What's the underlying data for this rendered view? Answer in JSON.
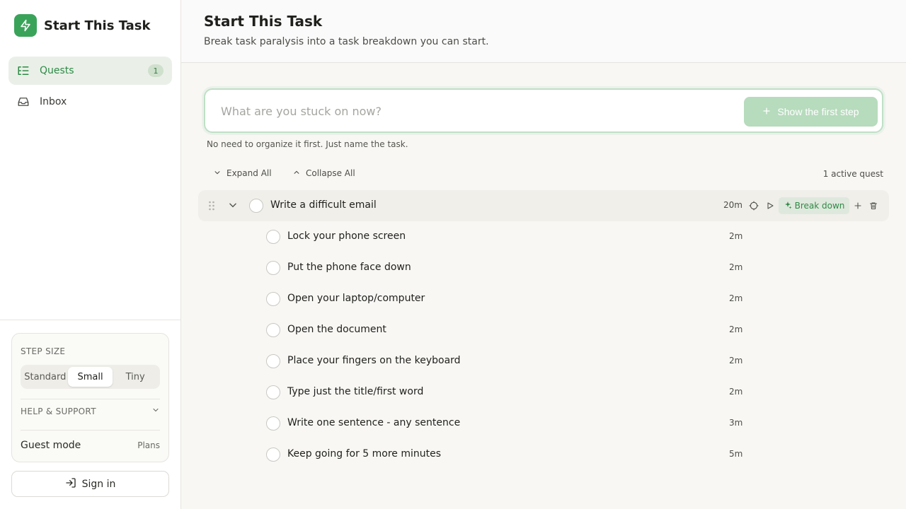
{
  "app": {
    "name": "Start This Task",
    "accent": "#3aa35a"
  },
  "sidebar": {
    "items": [
      {
        "label": "Quests",
        "icon": "list-tree-icon",
        "badge": "1",
        "active": true
      },
      {
        "label": "Inbox",
        "icon": "inbox-icon",
        "active": false
      }
    ],
    "step_size": {
      "label": "STEP SIZE",
      "options": [
        "Standard",
        "Small",
        "Tiny"
      ],
      "selected": "Small"
    },
    "help": {
      "label": "HELP & SUPPORT"
    },
    "guest": {
      "label": "Guest mode",
      "plans": "Plans"
    },
    "signin": {
      "label": "Sign in"
    }
  },
  "header": {
    "title": "Start This Task",
    "subtitle": "Break task paralysis into a task breakdown you can start."
  },
  "task_input": {
    "placeholder": "What are you stuck on now?",
    "value": "",
    "button": "Show the first step",
    "hint": "No need to organize it first. Just name the task."
  },
  "toolbar": {
    "expand_all": "Expand All",
    "collapse_all": "Collapse All",
    "active_count": "1 active quest"
  },
  "quest": {
    "title": "Write a difficult email",
    "time": "20m",
    "breakdown_label": "Break down",
    "subtasks": [
      {
        "title": "Lock your phone screen",
        "time": "2m"
      },
      {
        "title": "Put the phone face down",
        "time": "2m"
      },
      {
        "title": "Open your laptop/computer",
        "time": "2m"
      },
      {
        "title": "Open the document",
        "time": "2m"
      },
      {
        "title": "Place your fingers on the keyboard",
        "time": "2m"
      },
      {
        "title": "Type just the title/first word",
        "time": "2m"
      },
      {
        "title": "Write one sentence - any sentence",
        "time": "3m"
      },
      {
        "title": "Keep going for 5 more minutes",
        "time": "5m"
      }
    ]
  }
}
